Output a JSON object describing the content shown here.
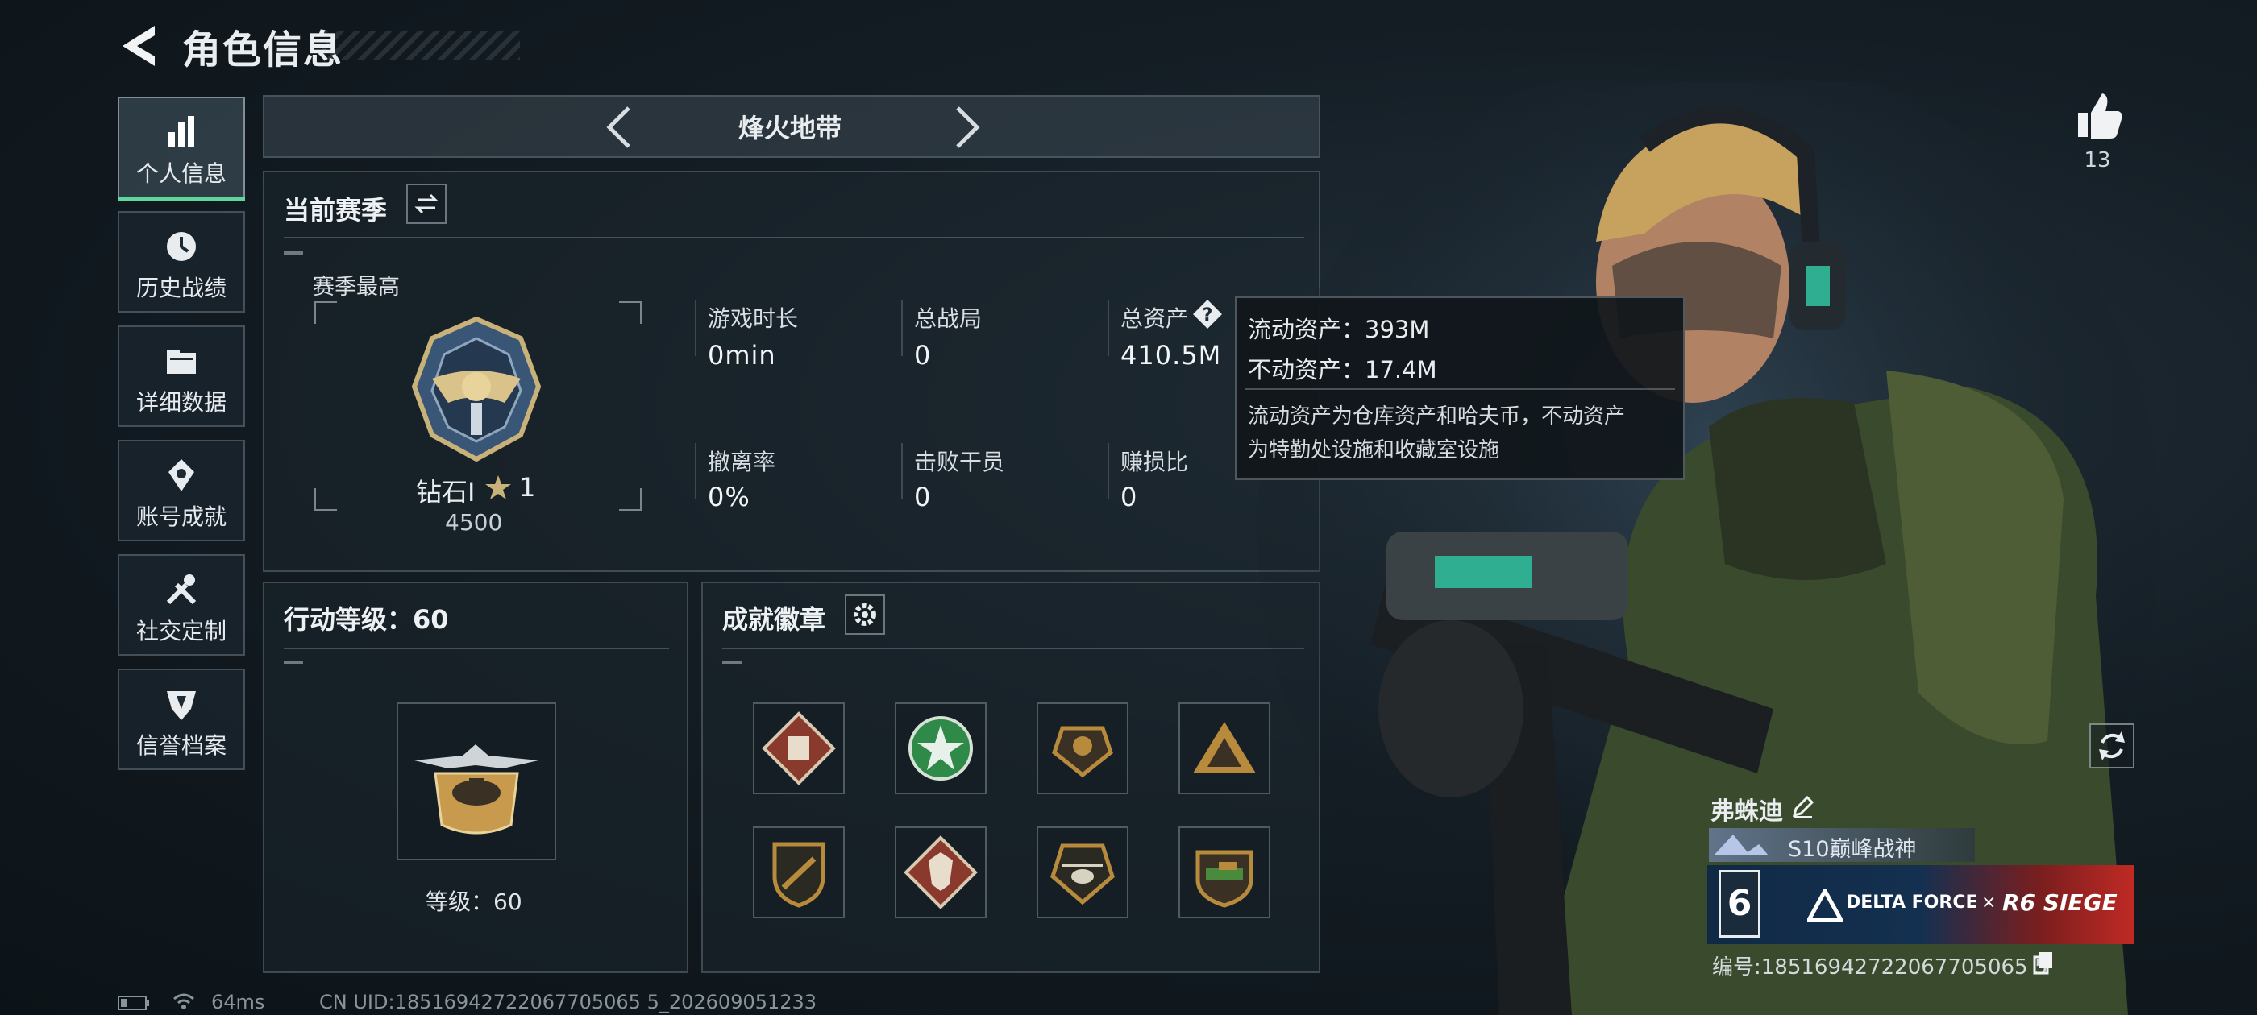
{
  "header": {
    "title": "角色信息",
    "back_icon": "back-arrow-icon"
  },
  "sidebar": {
    "items": [
      {
        "label": "个人信息",
        "icon": "bar-chart-icon",
        "active": true
      },
      {
        "label": "历史战绩",
        "icon": "history-clock-icon",
        "active": false
      },
      {
        "label": "详细数据",
        "icon": "folder-icon",
        "active": false
      },
      {
        "label": "账号成就",
        "icon": "achievement-icon",
        "active": false
      },
      {
        "label": "社交定制",
        "icon": "tools-icon",
        "active": false
      },
      {
        "label": "信誉档案",
        "icon": "shield-badge-icon",
        "active": false
      }
    ]
  },
  "mode_selector": {
    "label": "烽火地带"
  },
  "season": {
    "title": "当前赛季",
    "highest_label": "赛季最高",
    "rank_name": "钻石I",
    "rank_stars": "1",
    "rank_points": "4500",
    "stats": [
      {
        "label": "游戏时长",
        "value": "0min"
      },
      {
        "label": "总战局",
        "value": "0"
      },
      {
        "label": "总资产",
        "value": "410.5M"
      },
      {
        "label": "撤离率",
        "value": "0%"
      },
      {
        "label": "击败干员",
        "value": "0"
      },
      {
        "label": "赚损比",
        "value": "0"
      }
    ]
  },
  "tooltip": {
    "line1": "流动资产：393M",
    "line2": "不动资产：17.4M",
    "desc_line1": "流动资产为仓库资产和哈夫币，不动资产",
    "desc_line2": "为特勤处设施和收藏室设施"
  },
  "action_level": {
    "title": "行动等级：60",
    "level_text": "等级：60"
  },
  "badges": {
    "title": "成就徽章",
    "items": [
      {
        "icon": "fist-badge-icon",
        "color": "#8a3a2c"
      },
      {
        "icon": "star-badge-icon",
        "color": "#2f8a4a"
      },
      {
        "icon": "emblem-badge-icon",
        "color": "#b88a3c"
      },
      {
        "icon": "mountain-badge-icon",
        "color": "#b88a3c"
      },
      {
        "icon": "rifle-badge-icon",
        "color": "#b88a3c"
      },
      {
        "icon": "wolf-badge-icon",
        "color": "#8a3a2c"
      },
      {
        "icon": "helicopter-badge-icon",
        "color": "#b88a3c"
      },
      {
        "icon": "tank-badge-icon",
        "color": "#4a8a3c"
      }
    ]
  },
  "profile": {
    "likes": "13",
    "name": "弗蛛迪",
    "title_badge": "S10巅峰战神",
    "banner_left": "DELTA FORCE",
    "banner_x": "×",
    "banner_right": "R6 SIEGE",
    "banner_num": "6",
    "id_text": "编号:18516942722067705065 5"
  },
  "status_bar": {
    "ping": "64ms",
    "uid": "CN UID:18516942722067705065 5_202609051233"
  },
  "colors": {
    "accent_green": "#5fd69a",
    "panel_border": "#8c9ba5"
  }
}
